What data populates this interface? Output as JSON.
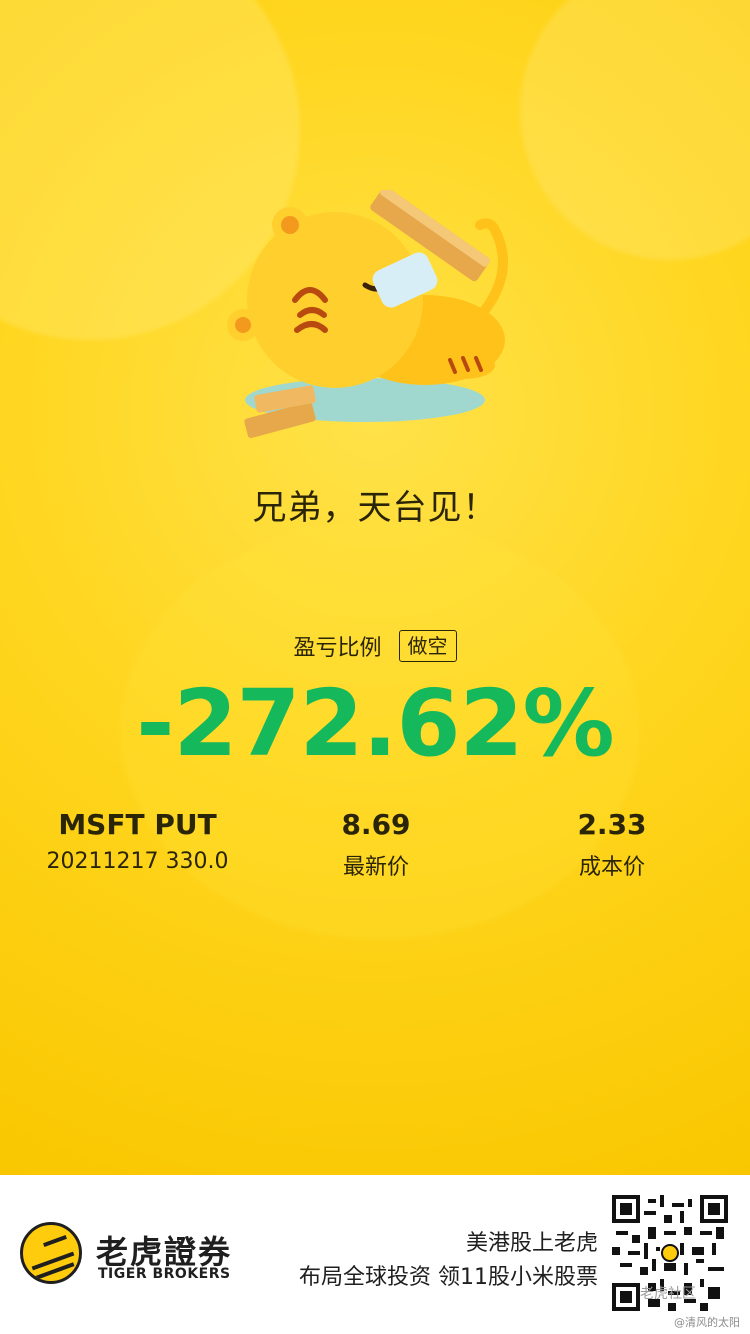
{
  "headline": "兄弟，天台见！",
  "ratio": {
    "label": "盈亏比例",
    "badge": "做空",
    "value": "-272.62%"
  },
  "contract": {
    "symbol": "MSFT PUT",
    "detail": "20211217  330.0"
  },
  "latest": {
    "value": "8.69",
    "label": "最新价"
  },
  "cost": {
    "value": "2.33",
    "label": "成本价"
  },
  "footer": {
    "brand_cn": "老虎證券",
    "brand_en": "TIGER BROKERS",
    "promo_line1": "美港股上老虎",
    "promo_line2": "布局全球投资 领11股小米股票",
    "watermark_user": "@清风的太阳",
    "watermark_site": "老虎社区"
  },
  "colors": {
    "background": "#ffd61f",
    "loss_green": "#16b85c",
    "text_dark": "#2b2508"
  }
}
